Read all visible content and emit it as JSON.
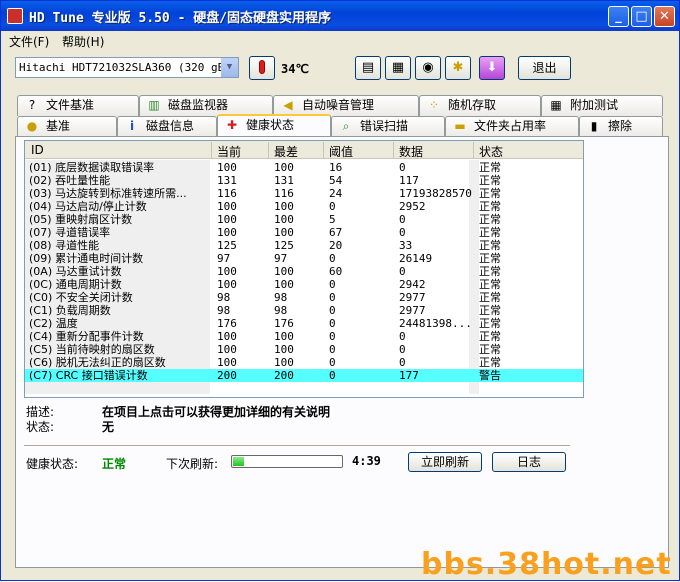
{
  "window": {
    "title": "HD Tune 专业版 5.50 - 硬盘/固态硬盘实用程序"
  },
  "menu": {
    "file": "文件(F)",
    "help": "帮助(H)"
  },
  "toolbar": {
    "drive": "Hitachi HDT721032SLA360 (320 gB)",
    "temperature": "34℃",
    "exit": "退出"
  },
  "tabs_top": [
    "文件基准",
    "磁盘监视器",
    "自动噪音管理",
    "随机存取",
    "附加测试"
  ],
  "tabs_bottom": [
    "基准",
    "磁盘信息",
    "健康状态",
    "错误扫描",
    "文件夹占用率",
    "擦除"
  ],
  "grid": {
    "headers": [
      "ID",
      "当前",
      "最差",
      "阈值",
      "数据",
      "状态"
    ],
    "rows": [
      [
        "(01) 底层数据读取错误率",
        "100",
        "100",
        "16",
        "0",
        "正常"
      ],
      [
        "(02) 吞吐量性能",
        "131",
        "131",
        "54",
        "117",
        "正常"
      ],
      [
        "(03) 马达旋转到标准转速所需...",
        "116",
        "116",
        "24",
        "17193828570",
        "正常"
      ],
      [
        "(04) 马达启动/停止计数",
        "100",
        "100",
        "0",
        "2952",
        "正常"
      ],
      [
        "(05) 重映射扇区计数",
        "100",
        "100",
        "5",
        "0",
        "正常"
      ],
      [
        "(07) 寻道错误率",
        "100",
        "100",
        "67",
        "0",
        "正常"
      ],
      [
        "(08) 寻道性能",
        "125",
        "125",
        "20",
        "33",
        "正常"
      ],
      [
        "(09) 累计通电时间计数",
        "97",
        "97",
        "0",
        "26149",
        "正常"
      ],
      [
        "(0A) 马达重试计数",
        "100",
        "100",
        "60",
        "0",
        "正常"
      ],
      [
        "(0C) 通电周期计数",
        "100",
        "100",
        "0",
        "2942",
        "正常"
      ],
      [
        "(C0) 不安全关闭计数",
        "98",
        "98",
        "0",
        "2977",
        "正常"
      ],
      [
        "(C1) 负载周期数",
        "98",
        "98",
        "0",
        "2977",
        "正常"
      ],
      [
        "(C2) 温度",
        "176",
        "176",
        "0",
        "24481398...",
        "正常"
      ],
      [
        "(C4) 重新分配事件计数",
        "100",
        "100",
        "0",
        "0",
        "正常"
      ],
      [
        "(C5) 当前待映射的扇区数",
        "100",
        "100",
        "0",
        "0",
        "正常"
      ],
      [
        "(C6) 脱机无法纠正的扇区数",
        "100",
        "100",
        "0",
        "0",
        "正常"
      ],
      [
        "(C7) CRC 接口错误计数",
        "200",
        "200",
        "0",
        "177",
        "警告"
      ]
    ]
  },
  "description": {
    "label": "描述:",
    "value": "在项目上点击可以获得更加详细的有关说明"
  },
  "state": {
    "label": "状态:",
    "value": "无"
  },
  "health": {
    "label": "健康状态:",
    "value": "正常"
  },
  "refresh": {
    "label": "下次刷新:",
    "progress": 0.1,
    "timer": "4:39",
    "refresh_button": "立即刷新",
    "log_button": "日志"
  },
  "watermark": "bbs.38hot.net"
}
